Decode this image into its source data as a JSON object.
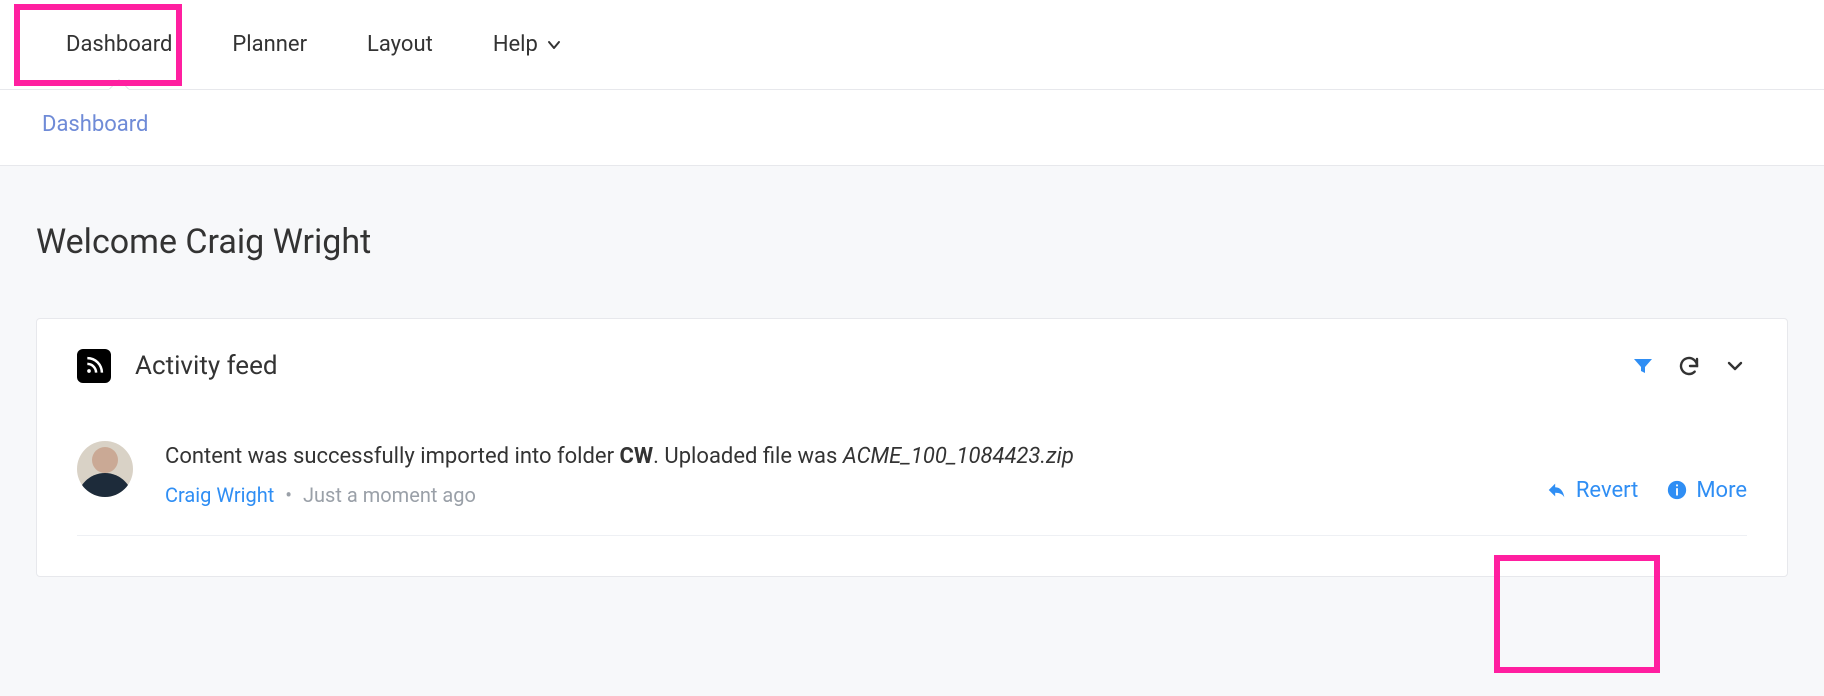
{
  "topnav": {
    "tabs": [
      {
        "label": "Dashboard",
        "active": true,
        "has_dropdown": false
      },
      {
        "label": "Planner",
        "active": false,
        "has_dropdown": false
      },
      {
        "label": "Layout",
        "active": false,
        "has_dropdown": false
      },
      {
        "label": "Help",
        "active": false,
        "has_dropdown": true
      }
    ]
  },
  "breadcrumb": {
    "current": "Dashboard"
  },
  "main": {
    "welcome_heading": "Welcome Craig Wright"
  },
  "activity_feed": {
    "title": "Activity feed",
    "tools": {
      "filter_icon": "filter-icon",
      "refresh_icon": "refresh-icon",
      "collapse_icon": "chevron-down-icon"
    },
    "items": [
      {
        "msg_prefix": "Content was successfully imported into folder ",
        "folder_name": "CW",
        "msg_middle": ". Uploaded file was ",
        "filename": "ACME_100_1084423.zip",
        "author": "Craig Wright",
        "timestamp": "Just a moment ago",
        "actions": {
          "revert_label": "Revert",
          "more_label": "More"
        }
      }
    ]
  },
  "highlights": [
    "dashboard-tab",
    "revert-button"
  ]
}
